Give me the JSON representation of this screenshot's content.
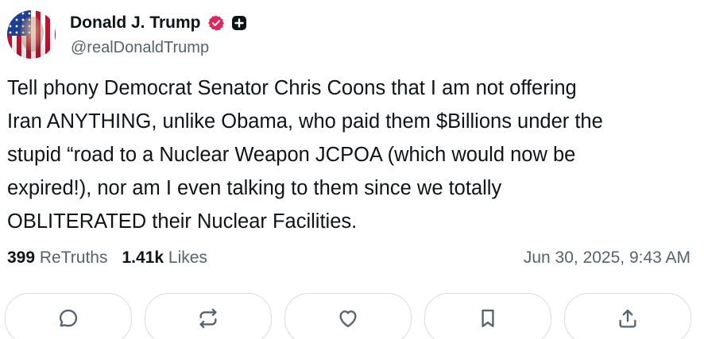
{
  "author": {
    "display_name": "Donald J. Trump",
    "handle": "@realDonaldTrump",
    "avatar_icon": "avatar-flag-portrait",
    "verified_color": "#e0245e"
  },
  "post": {
    "text": "Tell phony Democrat Senator Chris Coons that I am not offering\nIran ANYTHING, unlike Obama, who paid them $Billions under the\nstupid “road to a Nuclear Weapon JCPOA (which would now be\nexpired!), nor am I even talking to them since we totally\nOBLITERATED their Nuclear Facilities."
  },
  "stats": {
    "retruths_count": "399",
    "retruths_label": "ReTruths",
    "likes_count": "1.41k",
    "likes_label": "Likes",
    "timestamp": "Jun 30, 2025, 9:43 AM"
  },
  "actions": [
    {
      "name": "reply-button",
      "icon": "comment-icon"
    },
    {
      "name": "retruth-button",
      "icon": "repost-icon"
    },
    {
      "name": "like-button",
      "icon": "heart-icon"
    },
    {
      "name": "bookmark-button",
      "icon": "bookmark-icon"
    },
    {
      "name": "share-button",
      "icon": "share-icon"
    }
  ]
}
